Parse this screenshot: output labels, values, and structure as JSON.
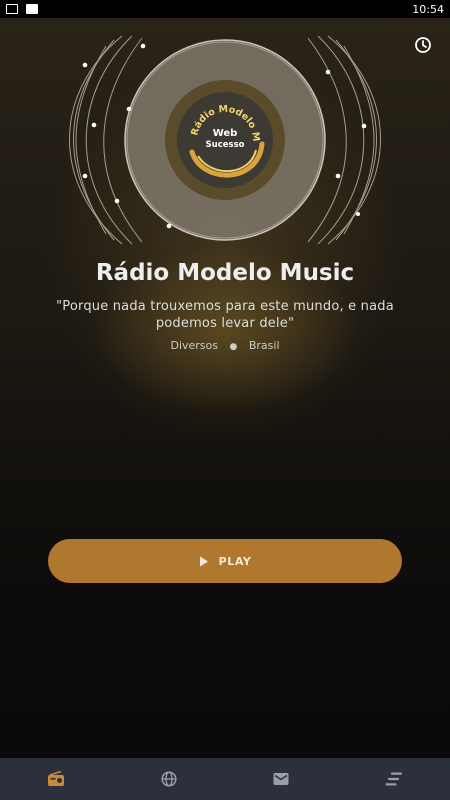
{
  "status_bar": {
    "time": "10:54"
  },
  "station": {
    "name": "Rádio Modelo Music",
    "slogan": "\"Porque nada trouxemos para este mundo, e nada podemos levar dele\"",
    "genre": "Diversos",
    "country": "Brasil"
  },
  "logo": {
    "arc_text": "Rádio Modelo Music",
    "line1": "Web",
    "line2": "Sucesso"
  },
  "player": {
    "play_label": "PLAY"
  },
  "nav": {
    "items": [
      {
        "icon": "radio-icon",
        "active": true
      },
      {
        "icon": "globe-icon",
        "active": false
      },
      {
        "icon": "mail-icon",
        "active": false
      },
      {
        "icon": "menu-icon",
        "active": false
      }
    ]
  },
  "colors": {
    "accent": "#b0782f",
    "nav_bg": "#2b303a",
    "nav_active": "#c98a3a",
    "nav_inactive": "#9aa0aa"
  }
}
